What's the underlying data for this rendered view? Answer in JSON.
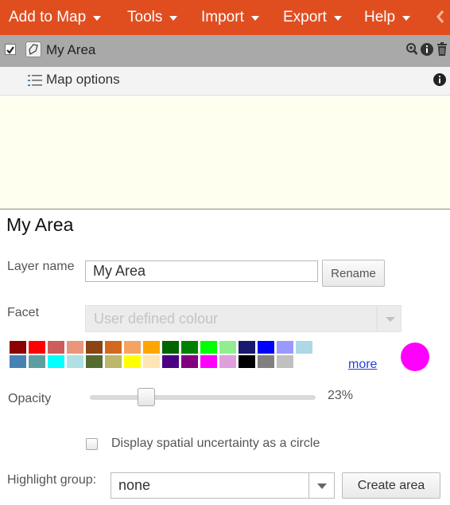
{
  "menu": {
    "items": [
      "Add to Map",
      "Tools",
      "Import",
      "Export",
      "Help"
    ],
    "collapse_icon": "chevron-left-icon",
    "bar_color": "#e04e20"
  },
  "layers": {
    "items": [
      {
        "name": "My Area",
        "checked": true,
        "icon": "area-icon",
        "actions": [
          "zoom-icon",
          "info-icon",
          "trash-icon"
        ]
      }
    ],
    "options_label": "Map options"
  },
  "panel": {
    "title": "My Area",
    "layer_name_label": "Layer name",
    "layer_name_value": "My Area",
    "rename_button": "Rename",
    "facet_label": "Facet",
    "facet_value": "User defined colour",
    "palette": [
      [
        "#8b0000",
        "#ff0000",
        "#cd5c5c",
        "#e9967a",
        "#8b4513",
        "#d2691e",
        "#f4a460",
        "#ffa500",
        "#006400",
        "#008000",
        "#00ff00",
        "#90ee90",
        "#191970",
        "#0000ff",
        "#9999ff",
        "#add8e6"
      ],
      [
        "#4682b4",
        "#5f9ea0",
        "#00ffff",
        "#b0e0e6",
        "#556b2f",
        "#bdb76b",
        "#ffff00",
        "#ffe4b5",
        "#4b0082",
        "#800080",
        "#ff00ff",
        "#dda0dd",
        "#000000",
        "#808080",
        "#c0c0c0"
      ]
    ],
    "more_link": "more",
    "selected_colour": "#ff00ff",
    "opacity_label": "Opacity",
    "opacity_value": "23%",
    "opacity_fraction": 0.23,
    "uncertainty_label": "Display spatial uncertainty as a circle",
    "uncertainty_checked": false,
    "highlight_label": "Highlight group:",
    "highlight_value": "none",
    "create_area_button": "Create area"
  }
}
